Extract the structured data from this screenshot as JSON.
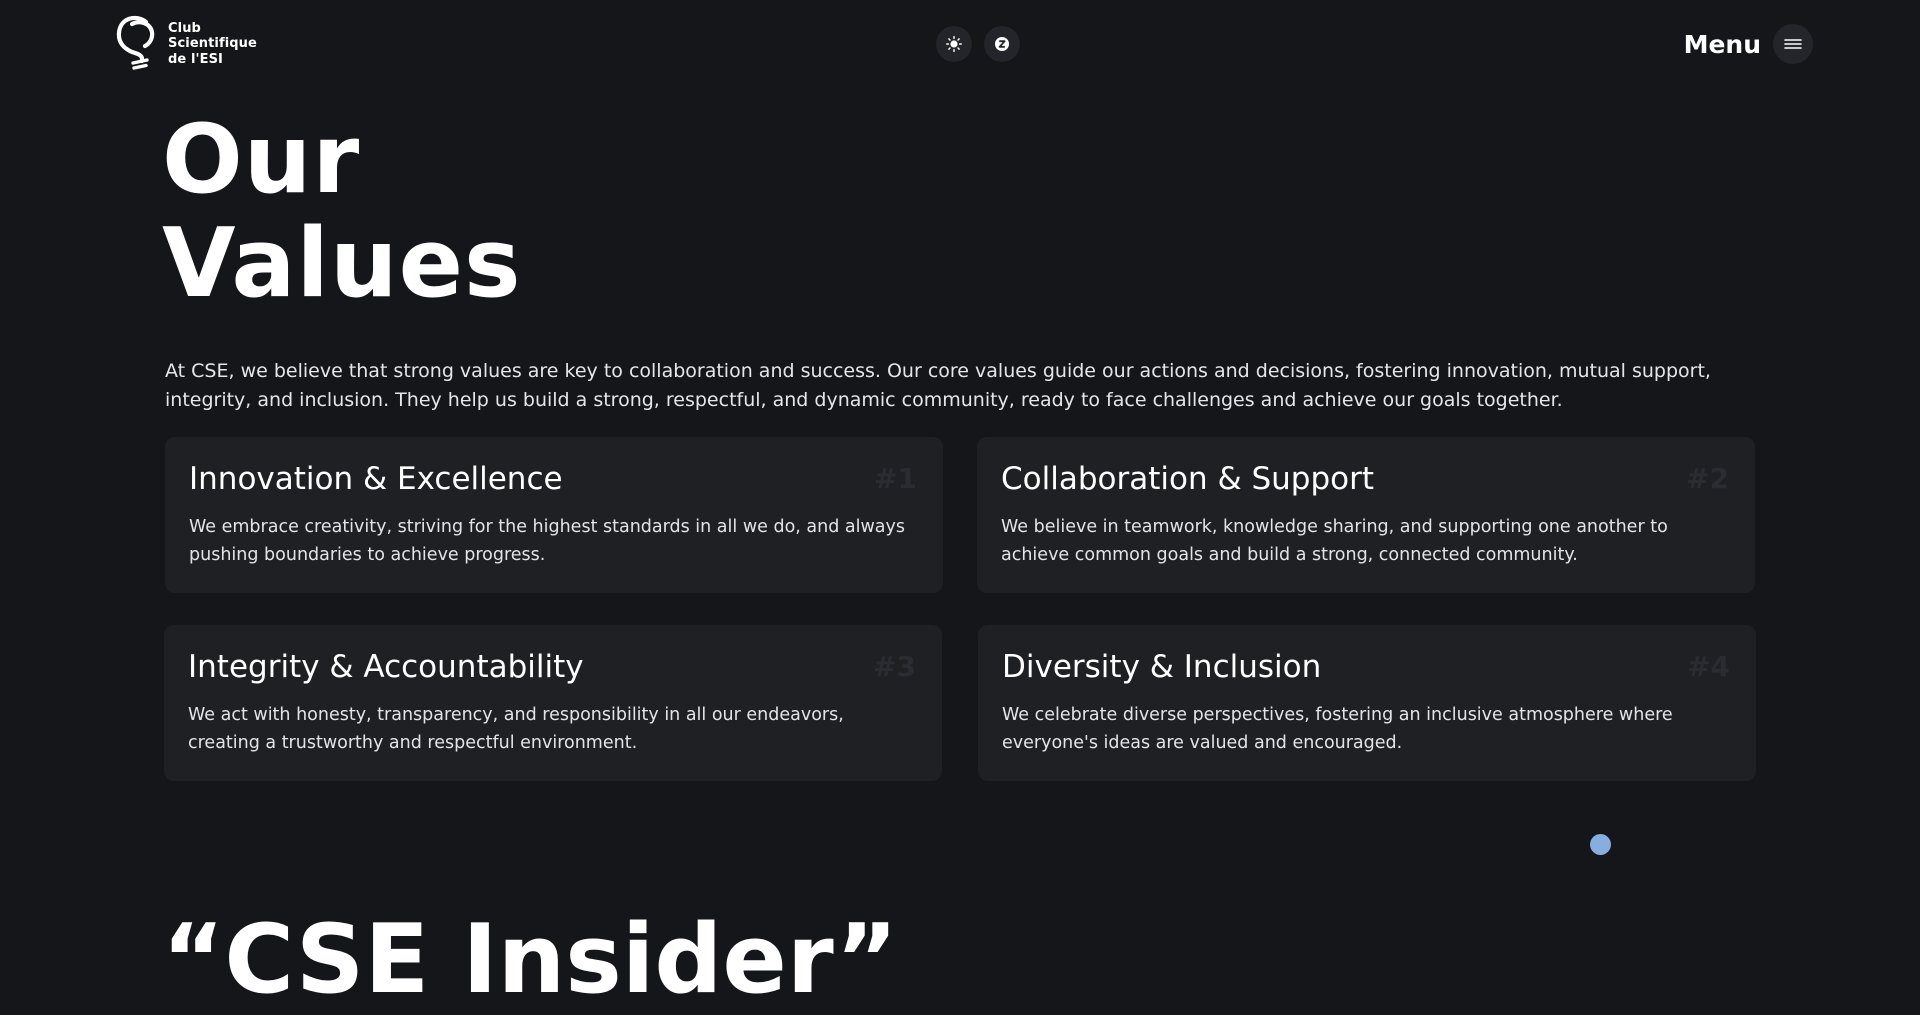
{
  "header": {
    "logo": {
      "line1": "Club",
      "line2": "Scientifique",
      "line3": "de l'ESI"
    },
    "toggles": [
      {
        "icon": "sun-icon"
      },
      {
        "icon": "language-icon"
      }
    ],
    "menu_label": "Menu",
    "menu_icon": "hamburger-icon"
  },
  "hero": {
    "title_line1": "Our",
    "title_line2": "Values",
    "intro": "At CSE, we believe that strong values are key to collaboration and success. Our core values guide our actions and decisions, fostering innovation, mutual support, integrity, and inclusion. They help us build a strong, respectful, and dynamic community, ready to face challenges and achieve our goals together."
  },
  "values": [
    {
      "title": "Innovation & Excellence",
      "number": "#1",
      "description": "We embrace creativity, striving for the highest standards in all we do, and always pushing boundaries to achieve progress."
    },
    {
      "title": "Collaboration & Support",
      "number": "#2",
      "description": "We believe in teamwork, knowledge sharing, and supporting one another to achieve common goals and build a strong, connected community."
    },
    {
      "title": "Integrity & Accountability",
      "number": "#3",
      "description": "We act with honesty, transparency, and responsibility in all our endeavors, creating a trustworthy and respectful environment."
    },
    {
      "title": "Diversity & Inclusion",
      "number": "#4",
      "description": "We celebrate diverse perspectives, fostering an inclusive atmosphere where everyone's ideas are valued and encouraged."
    }
  ],
  "next_section": {
    "heading_partial": "“CSE Insider”"
  },
  "colors": {
    "background": "#151619",
    "card": "#1f2024",
    "accent_dot": "#86aee0"
  }
}
